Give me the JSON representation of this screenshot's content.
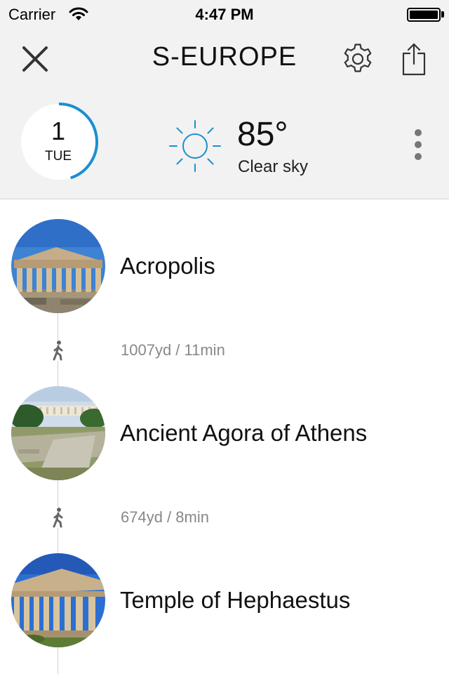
{
  "status_bar": {
    "carrier": "Carrier",
    "time": "4:47 PM",
    "wifi_icon": "wifi-icon",
    "battery_icon": "battery-icon"
  },
  "nav": {
    "title": "S-EUROPE",
    "close_icon": "close-icon",
    "settings_icon": "gear-icon",
    "share_icon": "share-icon"
  },
  "day": {
    "number": "1",
    "weekday": "TUE",
    "progress_fraction": 0.45,
    "accent_color": "#1a8fd1"
  },
  "weather": {
    "icon": "sun-icon",
    "temperature": "85°",
    "condition": "Clear sky",
    "icon_color": "#1a8fd1"
  },
  "more_icon": "more-vertical-icon",
  "places": [
    {
      "name": "Acropolis",
      "photo": "parthenon-photo"
    },
    {
      "name": "Ancient Agora of Athens",
      "photo": "agora-photo"
    },
    {
      "name": "Temple of Hephaestus",
      "photo": "temple-photo"
    }
  ],
  "legs": [
    {
      "mode_icon": "walk-icon",
      "text": "1007yd / 11min"
    },
    {
      "mode_icon": "walk-icon",
      "text": "674yd / 8min"
    }
  ]
}
